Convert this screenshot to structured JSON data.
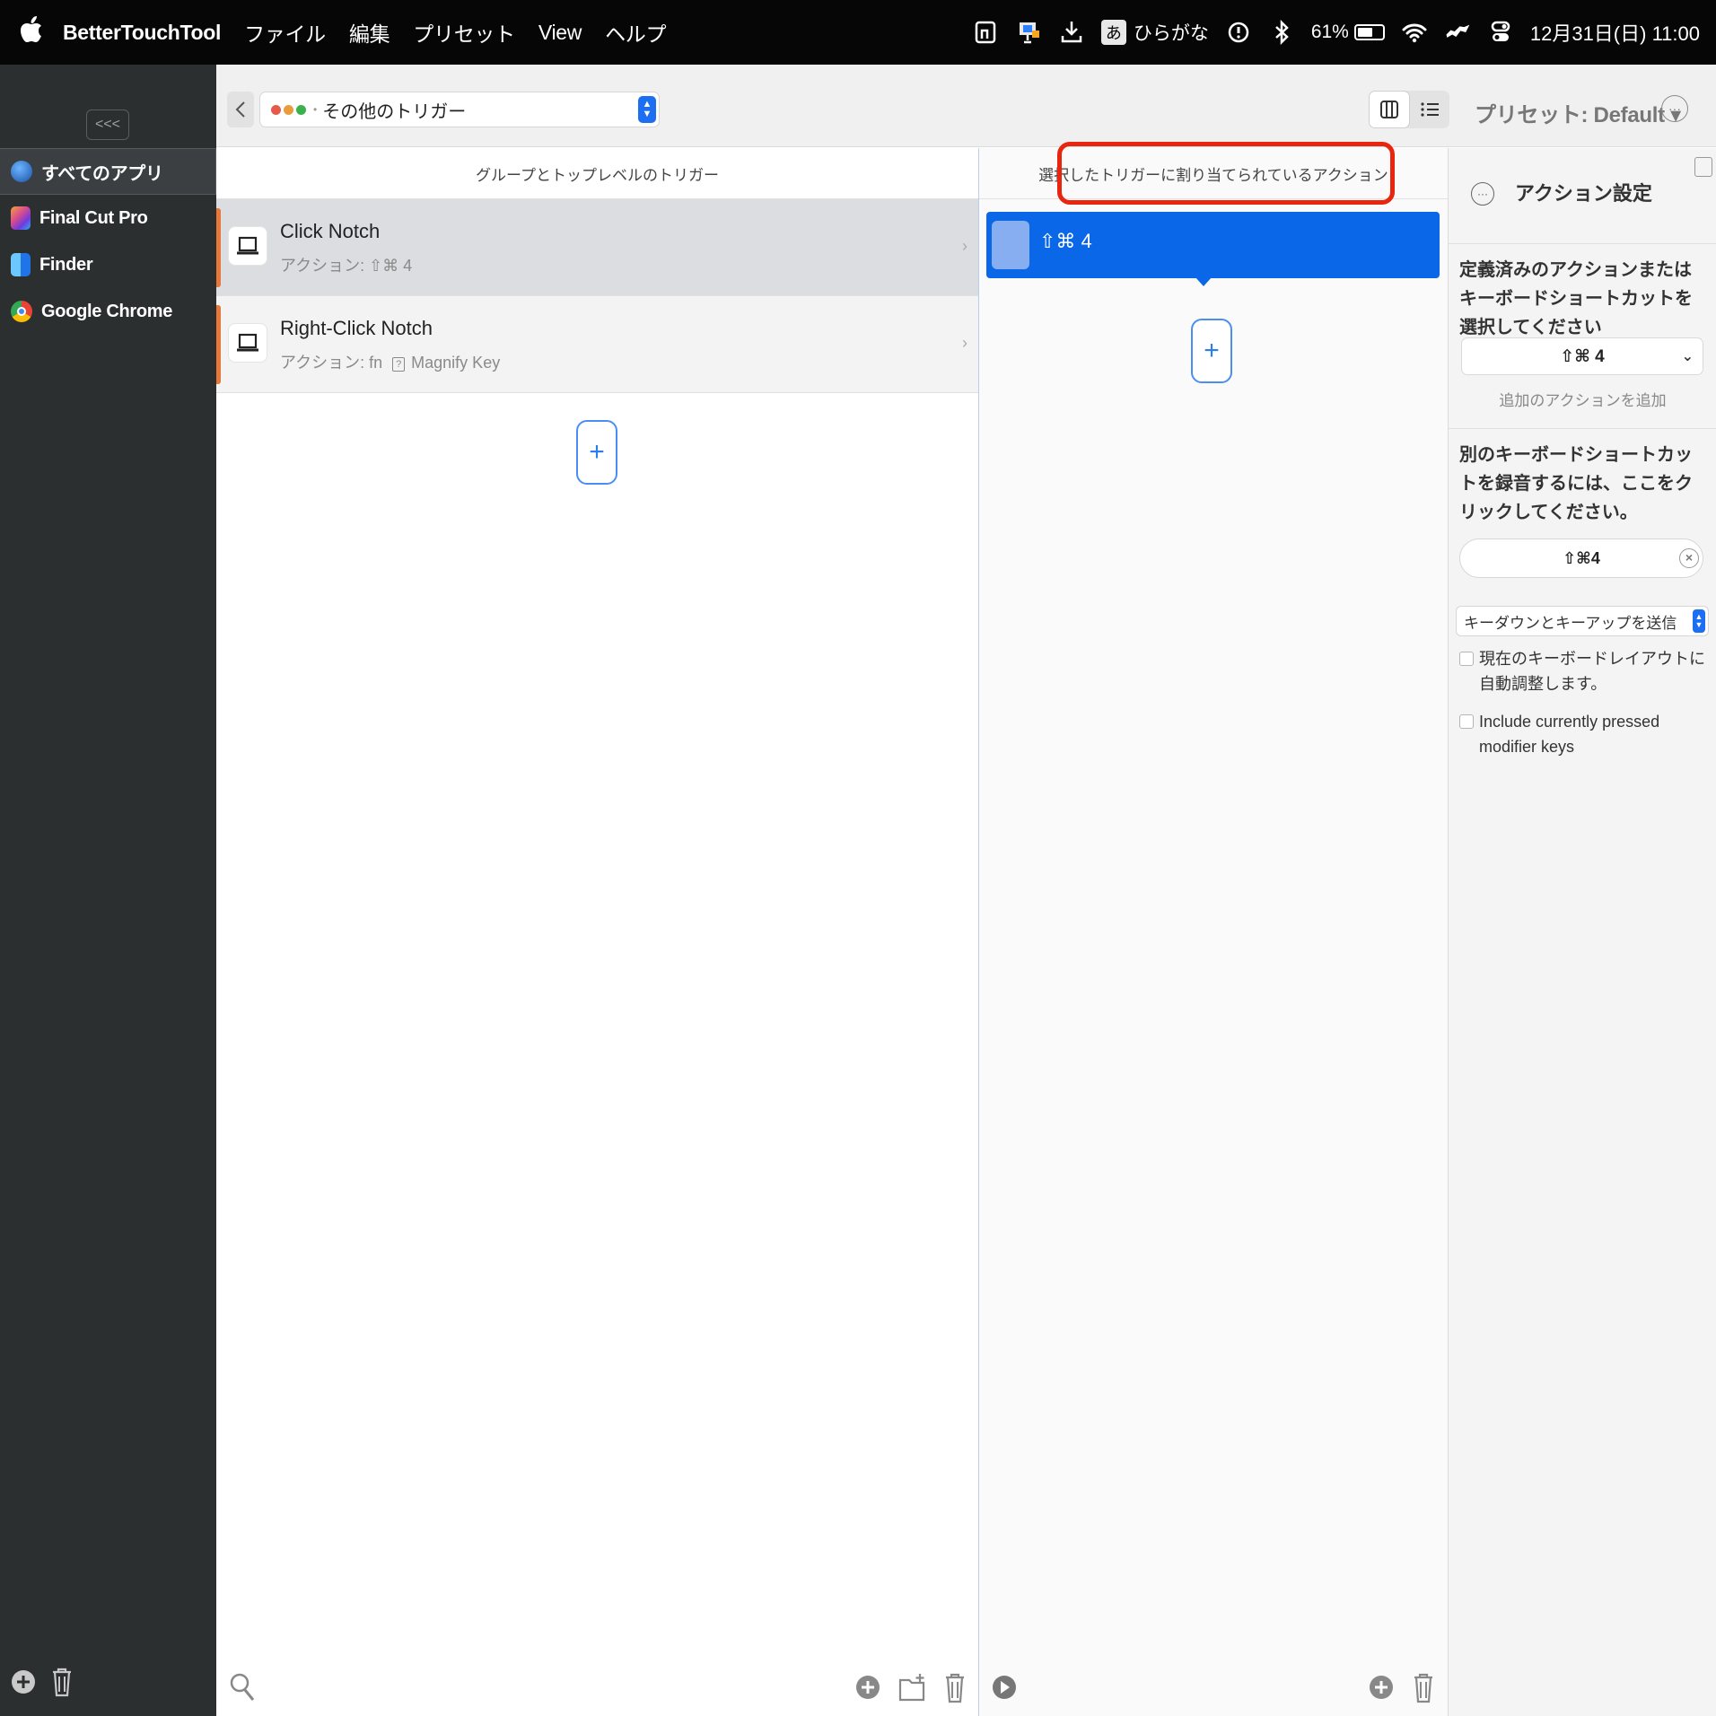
{
  "menubar": {
    "app_name": "BetterTouchTool",
    "menus": [
      "ファイル",
      "編集",
      "プリセット",
      "View",
      "ヘルプ"
    ],
    "ime_box": "あ",
    "ime_label": "ひらがな",
    "battery_percent": "61%",
    "battery_level": 0.61,
    "datetime": "12月31日(日)  11:00"
  },
  "sidebar": {
    "collapse_label": "<<<",
    "apps": [
      {
        "label": "すべてのアプリ",
        "icon": "globe-icon",
        "color": "#2a6fd6"
      },
      {
        "label": "Final Cut Pro",
        "icon": "final-cut-pro-icon",
        "color": "#7b3ad8"
      },
      {
        "label": "Finder",
        "icon": "finder-icon",
        "color": "#2f8cf0"
      },
      {
        "label": "Google Chrome",
        "icon": "chrome-icon",
        "color": "#e94335"
      }
    ]
  },
  "toolbar": {
    "back_label": "<",
    "trigger_category": "その他のトリガー",
    "preset_label": "プリセット: Default ▾",
    "more_label": "···"
  },
  "triggers": {
    "header": "グループとトップレベルのトリガー",
    "items": [
      {
        "title": "Click Notch",
        "subtitle": "アクション: ⇧⌘ 4",
        "selected": true
      },
      {
        "title": "Right-Click Notch",
        "subtitle_prefix": "アクション: fn",
        "subtitle_box": "?",
        "subtitle_suffix": "Magnify Key",
        "selected": false
      }
    ],
    "add_label": "+"
  },
  "actions": {
    "header": "選択したトリガーに割り当てられているアクション",
    "items": [
      {
        "label": "⇧⌘ 4",
        "selected": true
      }
    ],
    "add_label": "+"
  },
  "settings": {
    "title": "アクション設定",
    "predefined_prompt": "定義済みのアクションまたはキーボードショートカットを選択してください",
    "selected_shortcut": "⇧⌘ 4",
    "add_action_link": "追加のアクションを追加",
    "record_prompt": "別のキーボードショートカットを録音するには、ここをクリックしてください。",
    "recorded_shortcut": "⇧⌘4",
    "send_mode": "キーダウンとキーアップを送信",
    "checkbox_auto_layout": "現在のキーボードレイアウトに自動調整します。",
    "checkbox_modifiers": "Include currently pressed modifier keys"
  },
  "colors": {
    "accent": "#0a67e7",
    "highlight": "#e8250e",
    "sidebar_bg": "#2c2f30",
    "trigger_bar": "#e8773a"
  }
}
